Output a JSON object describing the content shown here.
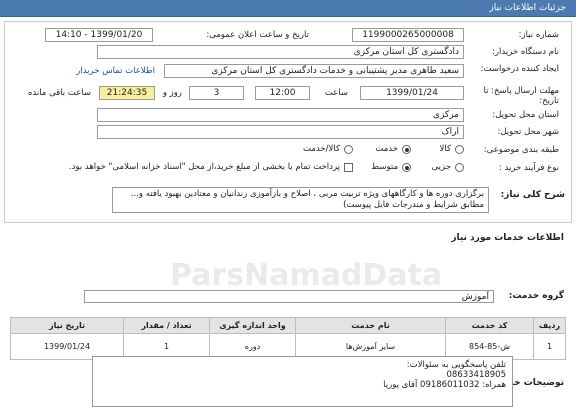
{
  "header": {
    "title": "جزئیات اطلاعات نیاز"
  },
  "form": {
    "need_number_label": "شماره نیاز:",
    "need_number": "1199000265000008",
    "announce_label": "تاریخ و ساعت اعلان عمومی:",
    "announce_value": "1399/01/20 - 14:10",
    "buyer_org_label": "نام دستگاه خریدار:",
    "buyer_org": "دادگستری کل استان مرکزی",
    "requester_label": "ایجاد کننده درخواست:",
    "requester": "سعید طاهری مدیر پشتیبانی و خدمات دادگستری کل استان مرکزی",
    "buyer_contact_link": "اطلاعات تماس خریدار",
    "deadline_label": "مهلت ارسال پاسخ: تا تاریخ:",
    "deadline_date": "1399/01/24",
    "time_label": "ساعت",
    "deadline_time": "12:00",
    "days_value": "3",
    "days_label": "روز و",
    "remaining_time": "21:24:35",
    "remaining_label": "ساعت باقی مانده",
    "province_label": "استان محل تحویل:",
    "province": "مرکزی",
    "city_label": "شهر محل تحویل:",
    "city": "اراک",
    "category_label": "طبقه بندی موضوعی:",
    "cat_goods": "کالا",
    "cat_service": "خدمت",
    "cat_goods_service": "کالا/خدمت",
    "purchase_type_label": "نوع فرآیند خرید :",
    "pt_partial": "جزیی",
    "pt_medium": "متوسط",
    "payment_note": "پرداخت تمام یا بخشی از مبلغ خرید،از محل \"اسناد خزانه اسلامی\" خواهد بود."
  },
  "summary": {
    "label": "شرح کلی نیاز:",
    "text": "برگزاری دوره ها و کارگاههای ویژه تربیت مربی ،  اصلاح و بازآموزی زندانیان و معتادین بهبود یافته و... مطابق شرایط و مندرجات فایل پیوست)"
  },
  "services": {
    "section_title": "اطلاعات خدمات مورد نیاز",
    "group_label": "گروه خدمت:",
    "group_value": "آموزش",
    "columns": [
      "ردیف",
      "کد خدمت",
      "نام خدمت",
      "واحد اندازه گیری",
      "تعداد / مقدار",
      "تاریخ نیاز"
    ],
    "rows": [
      [
        "1",
        "ش-85-854",
        "سایر آموزش‌ها",
        "دوره",
        "1",
        "1399/01/24"
      ]
    ]
  },
  "buyer_notes": {
    "label": "توضیحات خریدار:",
    "line1": "تلفن پاسخگویی به سئوالات:",
    "line2": "08633418905",
    "line3": "همراه: 09186011032 آقای پوریا"
  }
}
